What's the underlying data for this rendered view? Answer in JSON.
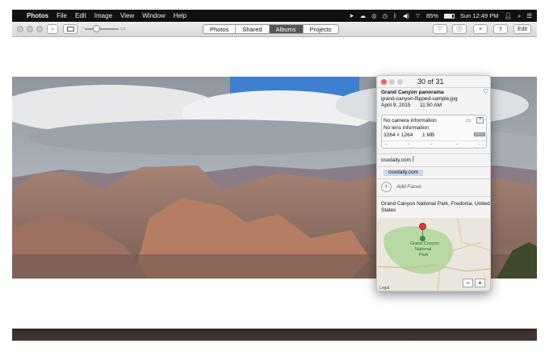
{
  "menubar": {
    "apple_glyph": "",
    "app_name": "Photos",
    "menus": [
      "File",
      "Edit",
      "Image",
      "View",
      "Window",
      "Help"
    ],
    "battery": "85%",
    "clock": "Sun 12:49 PM"
  },
  "toolbar": {
    "tabs": [
      "Photos",
      "Shared",
      "Albums",
      "Projects"
    ],
    "active_tab": "Albums",
    "edit_label": "Edit"
  },
  "inspector": {
    "counter": "30 of 31",
    "title": "Grand Canyon panorama",
    "filename": "grand-canyon-flipped-sample.jpg",
    "date": "April 9, 2015",
    "time": "11:50 AM",
    "camera_info": "No camera information",
    "lens_info": "No lens information",
    "dimensions": "3264 × 1264",
    "file_size": "1 MB",
    "format_badge": "JPEG",
    "exif_placeholders": [
      "-",
      "-",
      "-",
      "-",
      "-"
    ],
    "description_value": "osxdaily.com",
    "keyword": "osxdaily.com",
    "add_faces_label": "Add Faces",
    "location_line1": "Grand Canyon National Park, Fredonia, United",
    "location_line2": "States",
    "map_label_line1": "Grand Canyon",
    "map_label_line2": "National",
    "map_label_line3": "Park",
    "legal": "Legal",
    "zoom_out": "−",
    "zoom_in": "+"
  },
  "colors": {
    "accent_active_tab": "#555555",
    "keyword_chip": "#c9d9ee",
    "map_pin": "#e0393e",
    "park_green": "#b8d8a4"
  }
}
